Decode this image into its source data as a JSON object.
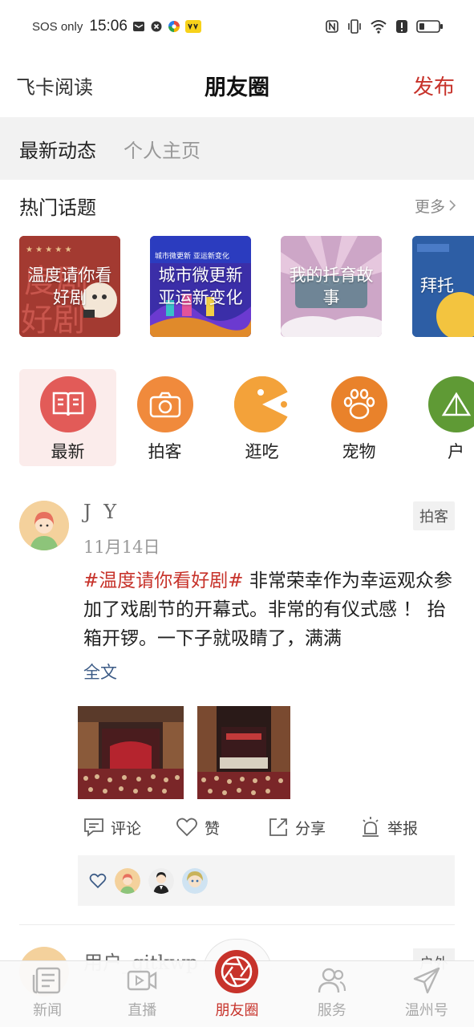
{
  "status_bar": {
    "carrier": "SOS only",
    "time": "15:06",
    "icons": [
      "mail-icon",
      "close-box-icon",
      "color-wheel-icon",
      "app-badge-icon",
      "nfc-icon",
      "vibrate-icon",
      "wifi-icon",
      "alert-icon",
      "battery-icon"
    ]
  },
  "header": {
    "left_label": "飞卡阅读",
    "title": "朋友圈",
    "right_label": "发布"
  },
  "tabs": [
    {
      "label": "最新动态",
      "active": true
    },
    {
      "label": "个人主页",
      "active": false
    }
  ],
  "hot": {
    "title": "热门话题",
    "more": "更多",
    "topics": [
      {
        "line1": "温度请你看",
        "line2": "好剧"
      },
      {
        "line1": "城市微更新",
        "line2": "亚运新变化"
      },
      {
        "line1": "我的托育故",
        "line2": "事"
      },
      {
        "line1": "拜托",
        "line2": ""
      }
    ]
  },
  "categories": [
    {
      "label": "最新",
      "icon": "book-icon",
      "color": "#e25b58",
      "active": true
    },
    {
      "label": "拍客",
      "icon": "camera-icon",
      "color": "#f08a3c",
      "active": false
    },
    {
      "label": "逛吃",
      "icon": "pacman-icon",
      "color": "#f3a23a",
      "active": false
    },
    {
      "label": "宠物",
      "icon": "paw-icon",
      "color": "#e9822b",
      "active": false
    },
    {
      "label": "户",
      "icon": "tent-icon",
      "color": "#5f9a35",
      "active": false
    }
  ],
  "post": {
    "user": "J Y",
    "date": "11月14日",
    "tag": "拍客",
    "hashtag": "#温度请你看好剧#",
    "text": " 非常荣幸作为幸运观众参加了戏剧节的开幕式。非常的有仪式感 ！ 抬箱开锣。一下子就吸睛了，满满",
    "full_text_link": "全文",
    "actions": [
      {
        "label": "评论",
        "icon": "comment-icon"
      },
      {
        "label": "赞",
        "icon": "heart-icon"
      },
      {
        "label": "分享",
        "icon": "share-icon"
      },
      {
        "label": "举报",
        "icon": "alarm-icon"
      }
    ]
  },
  "post2": {
    "user": "用户_gitkwp",
    "tag": "户外"
  },
  "bottom_nav": [
    {
      "label": "新闻",
      "icon": "news-icon",
      "active": false
    },
    {
      "label": "直播",
      "icon": "video-icon",
      "active": false
    },
    {
      "label": "朋友圈",
      "icon": "aperture-icon",
      "active": true
    },
    {
      "label": "服务",
      "icon": "people-icon",
      "active": false
    },
    {
      "label": "温州号",
      "icon": "paper-plane-icon",
      "active": false
    }
  ],
  "colors": {
    "accent": "#c7332b",
    "link": "#3c5b86",
    "tab_bg": "#f2f2f2"
  }
}
